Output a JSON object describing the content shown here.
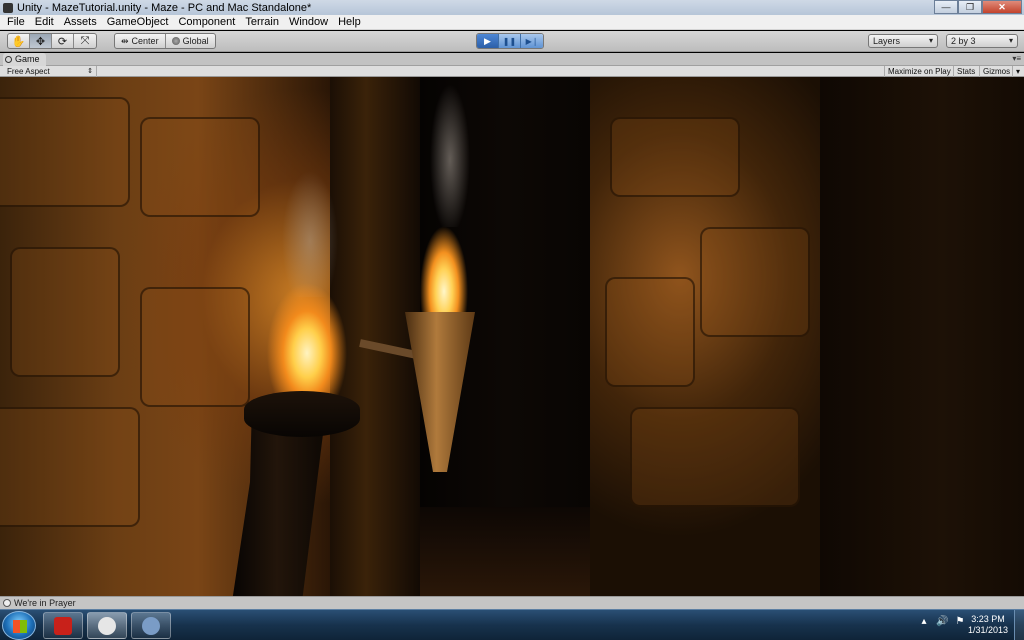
{
  "window": {
    "title": "Unity - MazeTutorial.unity - Maze - PC and Mac Standalone*",
    "minimize_glyph": "—",
    "maximize_glyph": "❐",
    "close_glyph": "✕"
  },
  "menu": [
    "File",
    "Edit",
    "Assets",
    "GameObject",
    "Component",
    "Terrain",
    "Window",
    "Help"
  ],
  "toolbar": {
    "tools": [
      {
        "name": "hand-tool-icon",
        "glyph": "✋"
      },
      {
        "name": "move-tool-icon",
        "glyph": "✥"
      },
      {
        "name": "rotate-tool-icon",
        "glyph": "⟳"
      },
      {
        "name": "scale-tool-icon",
        "glyph": "⤧"
      }
    ],
    "pivot_label": "Center",
    "space_label": "Global",
    "play_glyph": "▶",
    "pause_glyph": "❚❚",
    "step_glyph": "▶❘",
    "layers_label": "Layers",
    "layout_label": "2 by 3"
  },
  "game_tab": {
    "label": "Game",
    "aspect": "Free Aspect",
    "maximize_on_play": "Maximize on Play",
    "stats": "Stats",
    "gizmos": "Gizmos"
  },
  "status": {
    "message": "We're in Prayer"
  },
  "taskbar": {
    "apps": [
      {
        "name": "task-app-adobe",
        "color": "#c8211a"
      },
      {
        "name": "task-app-unity",
        "color": "#e6e6e6"
      },
      {
        "name": "task-app-monodevelop",
        "color": "#7a9cc6"
      }
    ],
    "clock_time": "3:23 PM",
    "clock_date": "1/31/2013"
  },
  "colors": {
    "play_accent": "#4d87d6",
    "torch_flame": "#ffcf4a"
  }
}
